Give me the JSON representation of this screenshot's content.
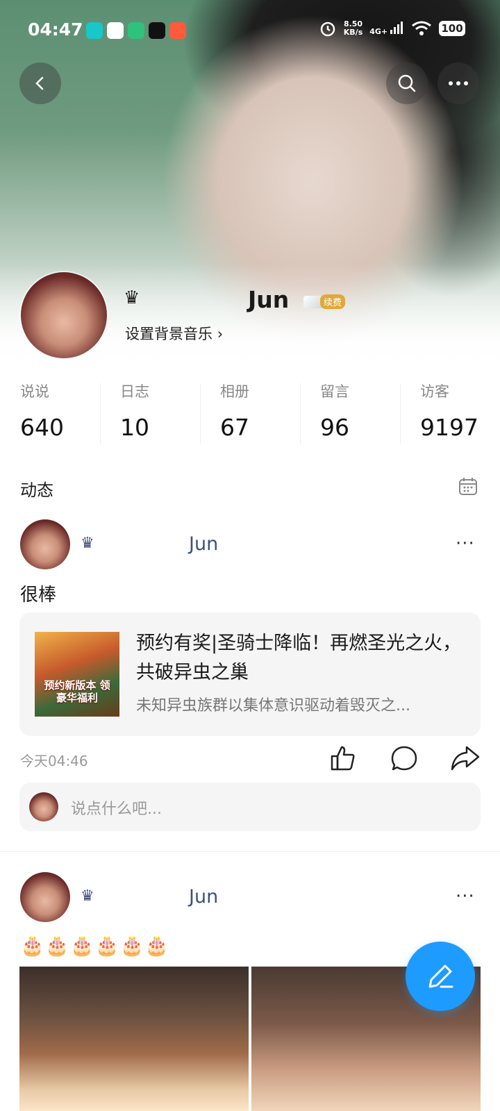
{
  "status_bar": {
    "time": "04:47",
    "net_speed_value": "8.50",
    "net_speed_unit": "KB/s",
    "signal": "4G+",
    "battery": "100"
  },
  "profile": {
    "name": "Jun",
    "vip_badge": "续费",
    "bg_music": "设置背景音乐",
    "bg_music_arrow": "›"
  },
  "stats": [
    {
      "label": "说说",
      "value": "640"
    },
    {
      "label": "日志",
      "value": "10"
    },
    {
      "label": "相册",
      "value": "67"
    },
    {
      "label": "留言",
      "value": "96"
    },
    {
      "label": "访客",
      "value": "9197"
    }
  ],
  "feed": {
    "title": "动态",
    "posts": [
      {
        "author": "Jun",
        "more": "···",
        "text": "很棒",
        "card": {
          "thumb_text": "预约新版本 领豪华福利",
          "title": "预约有奖|圣骑士降临！再燃圣光之火，共破异虫之巢",
          "subtitle": "未知异虫族群以集体意识驱动着毁灭之..."
        },
        "time": "今天04:46",
        "comment_placeholder": "说点什么吧..."
      },
      {
        "author": "Jun",
        "more": "···",
        "text": "🎂🎂🎂🎂🎂🎂"
      }
    ]
  },
  "icons": [
    "back-icon",
    "search-icon",
    "more-icon",
    "crown-icon",
    "calendar-icon",
    "like-icon",
    "comment-icon",
    "share-icon",
    "edit-icon"
  ],
  "colors": {
    "accent": "#1e9bff",
    "name_blue": "#3c5083"
  }
}
